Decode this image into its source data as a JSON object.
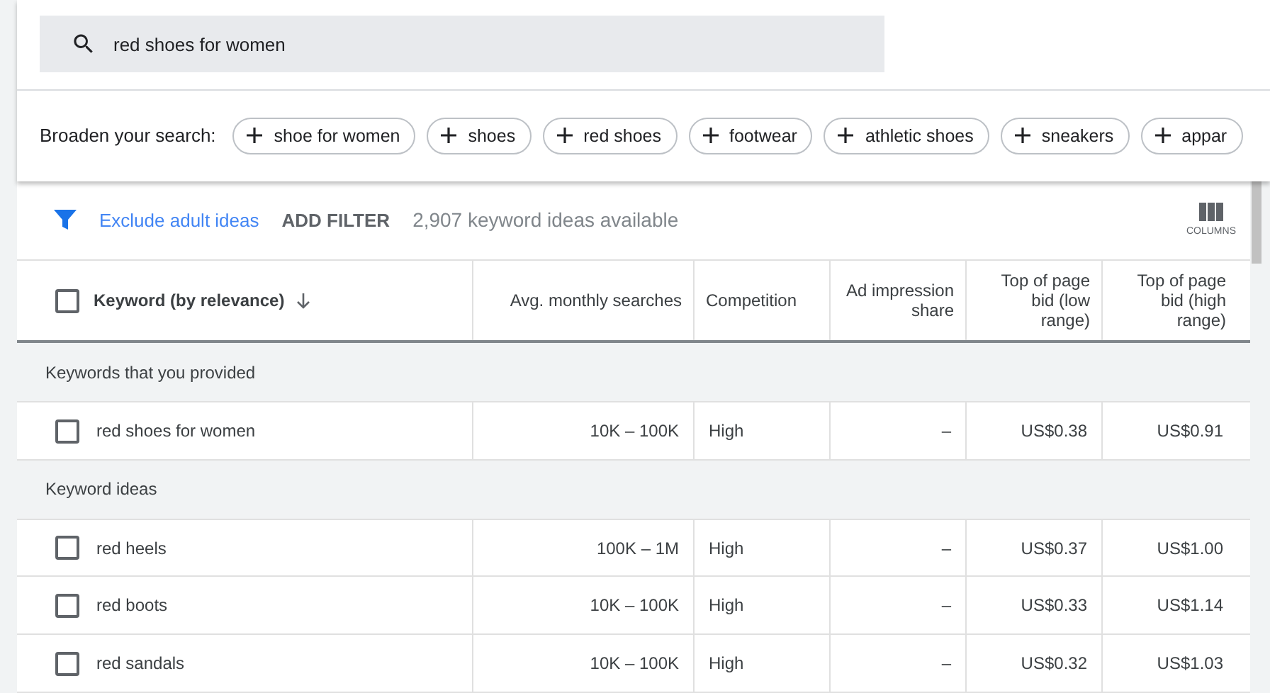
{
  "search": {
    "value": "red shoes for women"
  },
  "broaden": {
    "label": "Broaden your search:",
    "chips": [
      "shoe for women",
      "shoes",
      "red shoes",
      "footwear",
      "athletic shoes",
      "sneakers",
      "appar"
    ]
  },
  "toolbar": {
    "exclude_link": "Exclude adult ideas",
    "add_filter": "ADD FILTER",
    "count": "2,907 keyword ideas available",
    "columns_button": "COLUMNS"
  },
  "table": {
    "select_all": {
      "checked": false
    },
    "columns": [
      {
        "label": "Keyword (by relevance)",
        "sorted": true
      },
      {
        "label": "Avg. monthly searches",
        "sorted": false
      },
      {
        "label": "Competition",
        "sorted": false
      },
      {
        "label": "Ad impression share",
        "sorted": false
      },
      {
        "label": "Top of page bid (low range)",
        "sorted": false
      },
      {
        "label": "Top of page bid (high range)",
        "sorted": false
      }
    ],
    "groups": [
      {
        "title": "Keywords that you provided",
        "rows": [
          {
            "checked": false,
            "cells": [
              "red shoes for women",
              "10K – 100K",
              "High",
              "–",
              "US$0.38",
              "US$0.91"
            ]
          }
        ]
      },
      {
        "title": "Keyword ideas",
        "rows": [
          {
            "checked": false,
            "cells": [
              "red heels",
              "100K – 1M",
              "High",
              "–",
              "US$0.37",
              "US$1.00"
            ]
          },
          {
            "checked": false,
            "cells": [
              "red boots",
              "10K – 100K",
              "High",
              "–",
              "US$0.33",
              "US$1.14"
            ]
          },
          {
            "checked": false,
            "cells": [
              "red sandals",
              "10K – 100K",
              "High",
              "–",
              "US$0.32",
              "US$1.03"
            ]
          }
        ]
      }
    ]
  }
}
